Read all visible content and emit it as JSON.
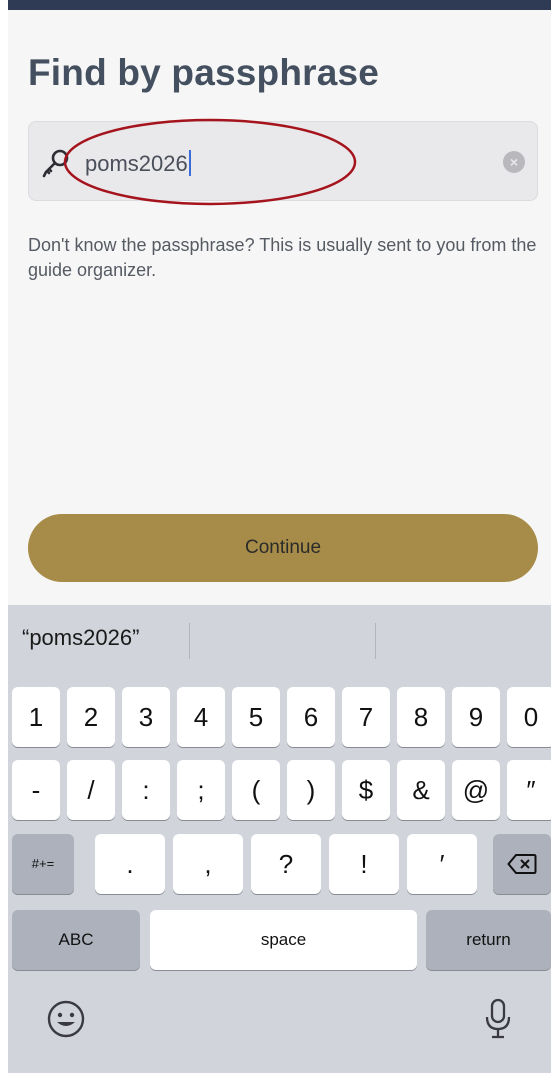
{
  "page": {
    "title": "Find by passphrase",
    "search": {
      "value": "poms2026",
      "key_icon": "key-icon",
      "clear_icon": "clear-circle-icon"
    },
    "hint": "Don't know the passphrase? This is usually sent to you from the guide organizer.",
    "continue_label": "Continue"
  },
  "colors": {
    "header_bar": "#2f3a55",
    "title": "#44505f",
    "continue_button": "#a68c48",
    "annotation_ellipse": "#a5141c",
    "keyboard_bg": "#d1d4db"
  },
  "keyboard": {
    "suggestion": "“poms2026”",
    "row1": [
      "1",
      "2",
      "3",
      "4",
      "5",
      "6",
      "7",
      "8",
      "9",
      "0"
    ],
    "row2": [
      "-",
      "/",
      ":",
      ";",
      "(",
      ")",
      "$",
      "&",
      "@",
      "″"
    ],
    "row3_left": "#+=",
    "row3": [
      ".",
      ",",
      "?",
      "!",
      "′"
    ],
    "row3_right_icon": "backspace-icon",
    "row4": {
      "abc": "ABC",
      "space": "space",
      "return": "return"
    },
    "emoji_icon": "emoji-icon",
    "mic_icon": "microphone-icon"
  }
}
